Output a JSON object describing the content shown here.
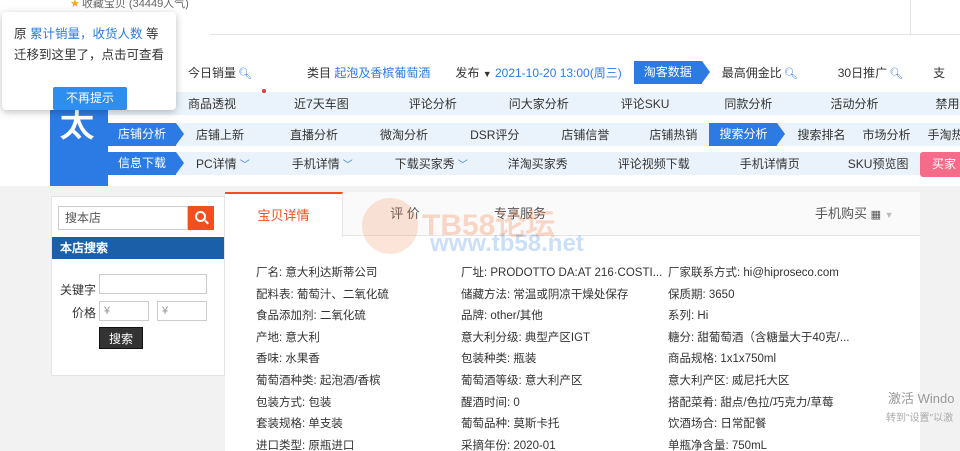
{
  "top": {
    "fav_text": "收藏宝贝 (34449人气)"
  },
  "popup": {
    "t1": "原",
    "t2": "累计销量，收货人数",
    "t3": "等",
    "t4": "迁移到这里了，点击可查看",
    "button": "不再提示"
  },
  "row1": {
    "sales_today": "今日销量",
    "category_label": "类目",
    "category_value": "起泡及香槟葡萄酒",
    "publish_label": "发布",
    "publish_value": "2021-10-20 13:00(周三)",
    "tag": "淘客数据",
    "commission": "最高佣金比",
    "promo30": "30日推广",
    "more": "支"
  },
  "row2": [
    "商品透视",
    "近7天车图",
    "评论分析",
    "问大家分析",
    "评论SKU",
    "同款分析",
    "活动分析",
    "禁用词检"
  ],
  "row3": {
    "tag1": "店铺分析",
    "items1": [
      "店铺上新",
      "直播分析",
      "微淘分析",
      "DSR评分",
      "店铺信誉",
      "店铺热销"
    ],
    "tag2": "搜索分析",
    "items2": [
      "搜索排名",
      "市场分析",
      "手淘热榜"
    ]
  },
  "row4": {
    "tag": "信息下载",
    "items": [
      "PC详情",
      "手机详情",
      "下载买家秀",
      "洋淘买家秀",
      "评论视频下载",
      "手机详情页",
      "SKU预览图"
    ],
    "red": "买家"
  },
  "sidebar": {
    "search_placeholder": "搜本店",
    "head": "本店搜索",
    "keyword": "关键字",
    "price": "价格",
    "yen1": "¥",
    "yen2": "¥",
    "go": "搜索"
  },
  "tabs": {
    "t1": "宝贝详情",
    "t2": "评 价",
    "t3": "专享服务",
    "mobile": "手机购买"
  },
  "attributes": [
    [
      "厂名: 意大利达斯蒂公司",
      "厂址: PRODOTTO DA:AT 216·COSTI...",
      "厂家联系方式: hi@hiproseco.com"
    ],
    [
      "配料表: 葡萄汁、二氧化硫",
      "储藏方法: 常温或阴凉干燥处保存",
      "保质期: 3650"
    ],
    [
      "食品添加剂: 二氧化硫",
      "品牌: other/其他",
      "系列: Hi"
    ],
    [
      "产地: 意大利",
      "意大利分级: 典型产区IGT",
      "糖分: 甜葡萄酒（含糖量大于40克/..."
    ],
    [
      "香味: 水果香",
      "包装种类: 瓶装",
      "商品规格: 1x1x750ml"
    ],
    [
      "葡萄酒种类: 起泡酒/香槟",
      "葡萄酒等级: 意大利产区",
      "意大利产区: 威尼托大区"
    ],
    [
      "包装方式: 包装",
      "醒酒时间: 0",
      "搭配菜肴: 甜点/色拉/巧克力/草莓"
    ],
    [
      "套装规格: 单支装",
      "葡萄品种: 莫斯卡托",
      "饮酒场合: 日常配餐"
    ],
    [
      "进口类型: 原瓶进口",
      "采摘年份: 2020-01",
      "单瓶净含量: 750mL"
    ]
  ],
  "watermark": {
    "line1": "TB58论坛",
    "line2": "www.tb58.net"
  },
  "windows": {
    "line1": "激活 Windo",
    "line2": "转到\"设置\"以激"
  }
}
